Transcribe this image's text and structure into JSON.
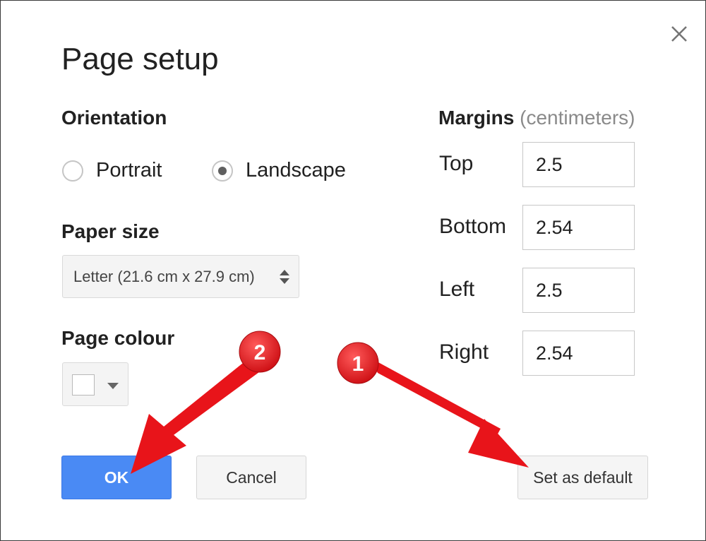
{
  "dialog": {
    "title": "Page setup"
  },
  "orientation": {
    "label": "Orientation",
    "options": [
      {
        "label": "Portrait",
        "selected": false
      },
      {
        "label": "Landscape",
        "selected": true
      }
    ]
  },
  "paper_size": {
    "label": "Paper size",
    "value": "Letter (21.6 cm x 27.9 cm)"
  },
  "page_colour": {
    "label": "Page colour",
    "value": "#ffffff"
  },
  "margins": {
    "title": "Margins",
    "unit": "(centimeters)",
    "fields": [
      {
        "label": "Top",
        "value": "2.5"
      },
      {
        "label": "Bottom",
        "value": "2.54"
      },
      {
        "label": "Left",
        "value": "2.5"
      },
      {
        "label": "Right",
        "value": "2.54"
      }
    ]
  },
  "buttons": {
    "ok": "OK",
    "cancel": "Cancel",
    "set_default": "Set as default"
  },
  "annotations": {
    "badge_1": "1",
    "badge_2": "2",
    "color": "#e8141a"
  },
  "colors": {
    "primary_button": "#4a8af4",
    "radio_selected": "#5f5f5f"
  }
}
